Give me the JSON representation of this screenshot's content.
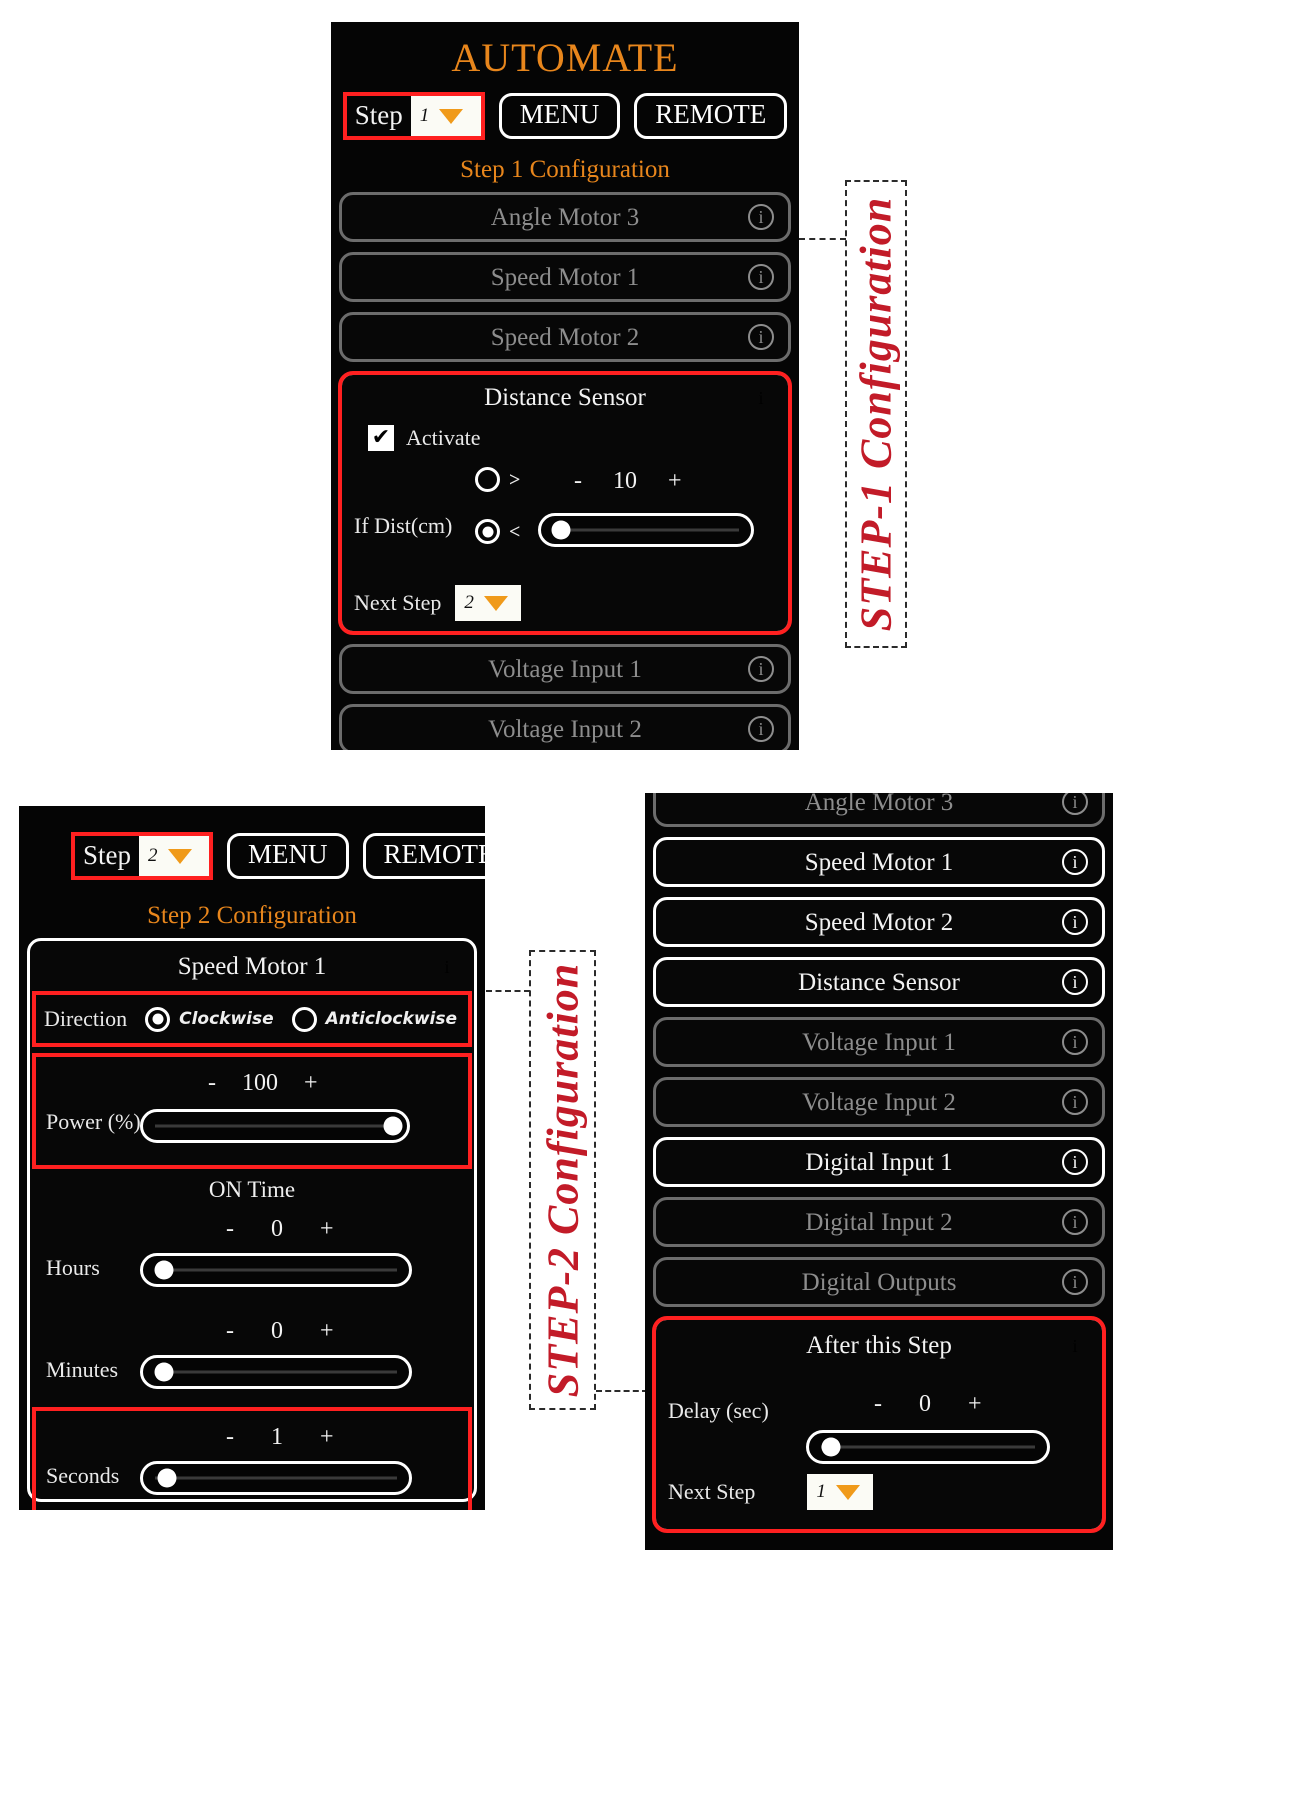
{
  "app": {
    "title": "AUTOMATE"
  },
  "icons": {
    "info": "i",
    "check": "✔",
    "caret": "caret-down-icon",
    "minus": "-",
    "plus": "+"
  },
  "colors": {
    "accent_orange": "#e8861c",
    "annotation_red": "#c21b28",
    "highlight_red": "#ff2020",
    "panel_black": "#050505",
    "enabled_white": "#ffffff",
    "disabled_gray": "#8d8d8d"
  },
  "panel_step1": {
    "app_title": "AUTOMATE",
    "topbar": {
      "step_label": "Step",
      "step_value": "1",
      "menu_label": "MENU",
      "remote_label": "REMOTE"
    },
    "config_title": "Step 1 Configuration",
    "modules": [
      {
        "name": "Angle Motor 3",
        "state": "disabled"
      },
      {
        "name": "Speed Motor 1",
        "state": "disabled"
      },
      {
        "name": "Speed Motor 2",
        "state": "disabled"
      }
    ],
    "expanded": {
      "name": "Distance Sensor",
      "activate_label": "Activate",
      "activate_checked": true,
      "condition_label": "If Dist(cm)",
      "option_greater": ">",
      "option_less": "<",
      "selected_option": "<",
      "value": "10",
      "minus": "-",
      "plus": "+",
      "slider_percent": 8,
      "next_step_label": "Next Step",
      "next_step_value": "2"
    },
    "modules_after": [
      {
        "name": "Voltage Input 1",
        "state": "disabled"
      },
      {
        "name": "Voltage Input 2",
        "state": "disabled"
      }
    ],
    "annotation": "STEP-1 Configuration"
  },
  "panel_step2_left": {
    "topbar": {
      "step_label": "Step",
      "step_value": "2",
      "menu_label": "MENU",
      "remote_label": "REMOTE"
    },
    "config_title": "Step 2 Configuration",
    "expanded": {
      "name": "Speed Motor 1",
      "direction_label": "Direction",
      "direction_options": [
        "Clockwise",
        "Anticlockwise"
      ],
      "direction_selected": "Clockwise",
      "power_label": "Power (%)",
      "power_value": "100",
      "power_percent": 100,
      "on_time_label": "ON Time",
      "time_rows": [
        {
          "label": "Hours",
          "value": "0",
          "percent": 2
        },
        {
          "label": "Minutes",
          "value": "0",
          "percent": 2
        },
        {
          "label": "Seconds",
          "value": "1",
          "percent": 3
        }
      ],
      "minus": "-",
      "plus": "+"
    },
    "annotation": "STEP-2 Configuration"
  },
  "panel_step2_right": {
    "modules": [
      {
        "name": "Angle Motor 3",
        "state": "disabled"
      },
      {
        "name": "Speed Motor 1",
        "state": "enabled"
      },
      {
        "name": "Speed Motor 2",
        "state": "enabled"
      },
      {
        "name": "Distance Sensor",
        "state": "enabled"
      },
      {
        "name": "Voltage Input 1",
        "state": "disabled"
      },
      {
        "name": "Voltage Input 2",
        "state": "disabled"
      },
      {
        "name": "Digital Input 1",
        "state": "enabled"
      },
      {
        "name": "Digital Input 2",
        "state": "disabled"
      },
      {
        "name": "Digital Outputs",
        "state": "disabled"
      }
    ],
    "after_step": {
      "name": "After this Step",
      "delay_label": "Delay (sec)",
      "delay_value": "0",
      "delay_percent": 3,
      "minus": "-",
      "plus": "+",
      "next_step_label": "Next Step",
      "next_step_value": "1"
    }
  }
}
